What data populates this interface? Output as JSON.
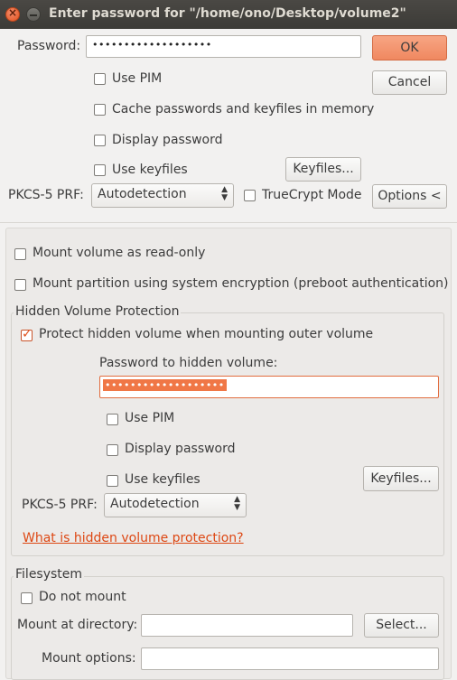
{
  "window": {
    "title": "Enter password for \"/home/ono/Desktop/volume2\"",
    "close_glyph": "×"
  },
  "password": {
    "label": "Password:",
    "masked": "•••••••••••••••••••"
  },
  "buttons": {
    "ok": "OK",
    "cancel": "Cancel",
    "keyfiles": "Keyfiles...",
    "options": "Options <"
  },
  "options": {
    "use_pim": "Use PIM",
    "cache": "Cache passwords and keyfiles in memory",
    "display_password": "Display password",
    "use_keyfiles": "Use keyfiles",
    "truecrypt_mode": "TrueCrypt Mode"
  },
  "prf": {
    "label": "PKCS-5 PRF:",
    "value": "Autodetection"
  },
  "mount": {
    "read_only": "Mount volume as read-only",
    "system_encryption": "Mount partition using system encryption (preboot authentication)"
  },
  "hidden": {
    "section_title": "Hidden Volume Protection",
    "protect": "Protect hidden volume when mounting outer volume",
    "password_label": "Password to hidden volume:",
    "masked": "•••••••••••••••••••",
    "use_pim": "Use PIM",
    "display_password": "Display password",
    "use_keyfiles": "Use keyfiles",
    "keyfiles_button": "Keyfiles...",
    "prf_label": "PKCS-5 PRF:",
    "prf_value": "Autodetection",
    "help_link": "What is hidden volume protection?"
  },
  "filesystem": {
    "section_title": "Filesystem",
    "do_not_mount": "Do not mount",
    "mount_dir_label": "Mount at directory:",
    "mount_dir_value": "",
    "select_button": "Select...",
    "mount_options_label": "Mount options:",
    "mount_options_value": ""
  },
  "colors": {
    "accent": "#e0531f",
    "ok_button": "#f08860",
    "titlebar": "#3c3b37"
  }
}
